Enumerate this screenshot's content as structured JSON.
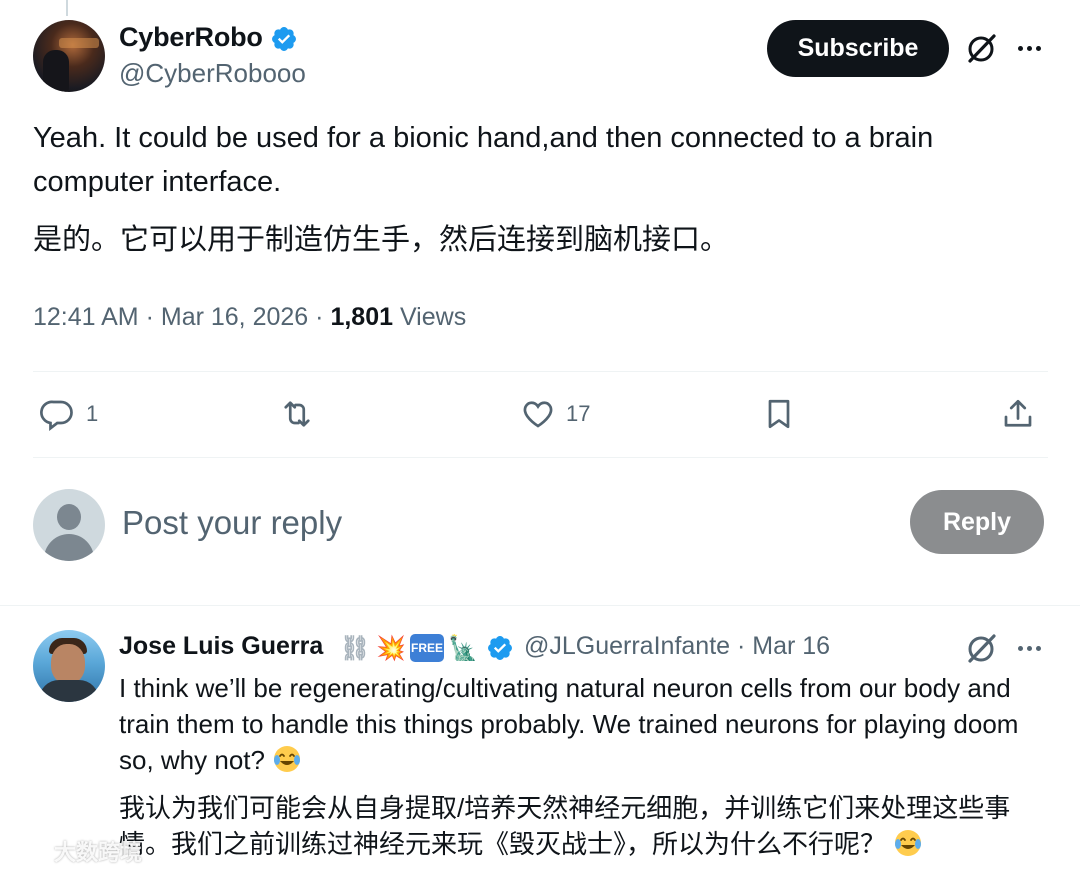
{
  "post": {
    "author": {
      "display_name": "CyberRobo",
      "handle": "@CyberRobooo",
      "verified": true
    },
    "subscribe_label": "Subscribe",
    "text_en": "Yeah. It could be used for a bionic hand,and then connected to a brain computer interface.",
    "text_cn": "是的。它可以用于制造仿生手，然后连接到脑机接口。",
    "meta": {
      "time": "12:41 AM",
      "date": "Mar 16, 2026",
      "views_count": "1,801",
      "views_label": "Views"
    },
    "actions": {
      "reply_count": "1",
      "repost_count": "",
      "like_count": "17"
    }
  },
  "composer": {
    "placeholder": "Post your reply",
    "reply_label": "Reply"
  },
  "reply": {
    "author": {
      "display_name": "Jose Luis Guerra",
      "emojis": [
        "⛓",
        "💥",
        "FREE",
        "🗽"
      ],
      "handle_date": "@JLGuerraInfante · Mar 16",
      "verified": true
    },
    "text_en": "I think we’ll be regenerating/cultivating natural neuron cells from our body and train them to handle this things probably. We trained neurons for playing doom so, why not?",
    "text_cn": "我认为我们可能会从自身提取/培养天然神经元细胞，并训练它们来处理这些事情。我们之前训练过神经元来玩《毁灭战士》，所以为什么不行呢？"
  },
  "watermark": {
    "text": "大数跨境"
  },
  "colors": {
    "text": "#0f1419",
    "secondary": "#536471",
    "verified": "#1d9bf0",
    "divider": "#eff3f4",
    "reply_btn": "#8b8d8f"
  }
}
